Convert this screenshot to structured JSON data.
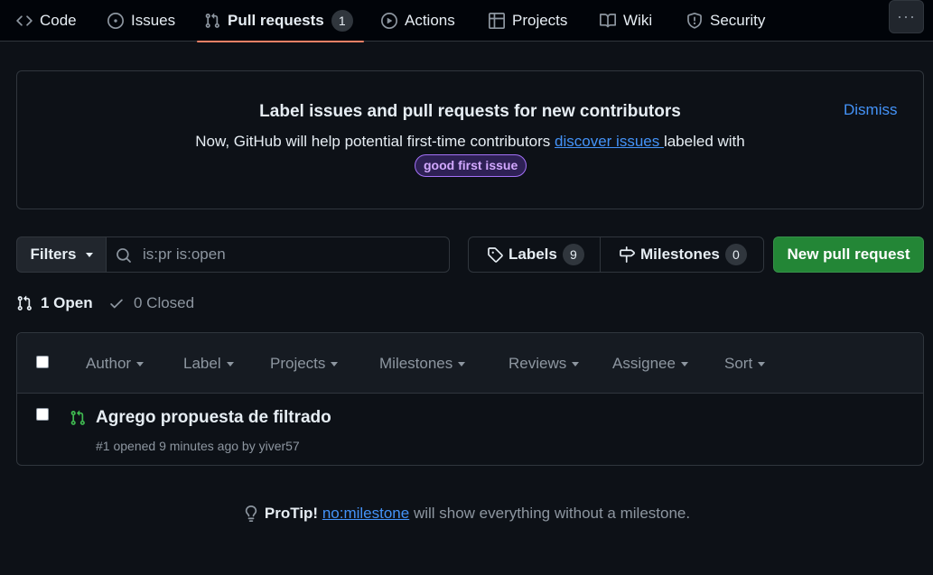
{
  "nav": {
    "tabs": [
      {
        "label": "Code",
        "icon": "code-icon"
      },
      {
        "label": "Issues",
        "icon": "issue-opened-icon"
      },
      {
        "label": "Pull requests",
        "icon": "git-pull-request-icon",
        "count": "1",
        "selected": true
      },
      {
        "label": "Actions",
        "icon": "play-icon"
      },
      {
        "label": "Projects",
        "icon": "table-icon"
      },
      {
        "label": "Wiki",
        "icon": "book-icon"
      },
      {
        "label": "Security",
        "icon": "shield-icon"
      }
    ],
    "more_label": "···"
  },
  "banner": {
    "title": "Label issues and pull requests for new contributors",
    "desc_before": "Now, GitHub will help potential first-time contributors ",
    "desc_link": "discover issues ",
    "desc_after": "labeled with",
    "label": "good first issue",
    "dismiss": "Dismiss"
  },
  "toolbar": {
    "filters_label": "Filters",
    "search_placeholder": "is:pr is:open",
    "labels_label": "Labels",
    "labels_count": "9",
    "milestones_label": "Milestones",
    "milestones_count": "0",
    "new_pr_label": "New pull request"
  },
  "states": {
    "open_label": "1 Open",
    "closed_label": "0 Closed"
  },
  "list_filters": [
    "Author",
    "Label",
    "Projects",
    "Milestones",
    "Reviews",
    "Assignee",
    "Sort"
  ],
  "pull_requests": [
    {
      "title": "Agrego propuesta de filtrado",
      "meta": "#1 opened 9 minutes ago by yiver57"
    }
  ],
  "protip": {
    "prefix": "ProTip!",
    "link": "no:milestone",
    "suffix": " will show everything without a milestone."
  },
  "colors": {
    "accent": "#4493f8",
    "primary_button": "#238636",
    "selected_tab_underline": "#f78166",
    "pr_open": "#3fb950",
    "good_first_issue": "#a371f7"
  }
}
